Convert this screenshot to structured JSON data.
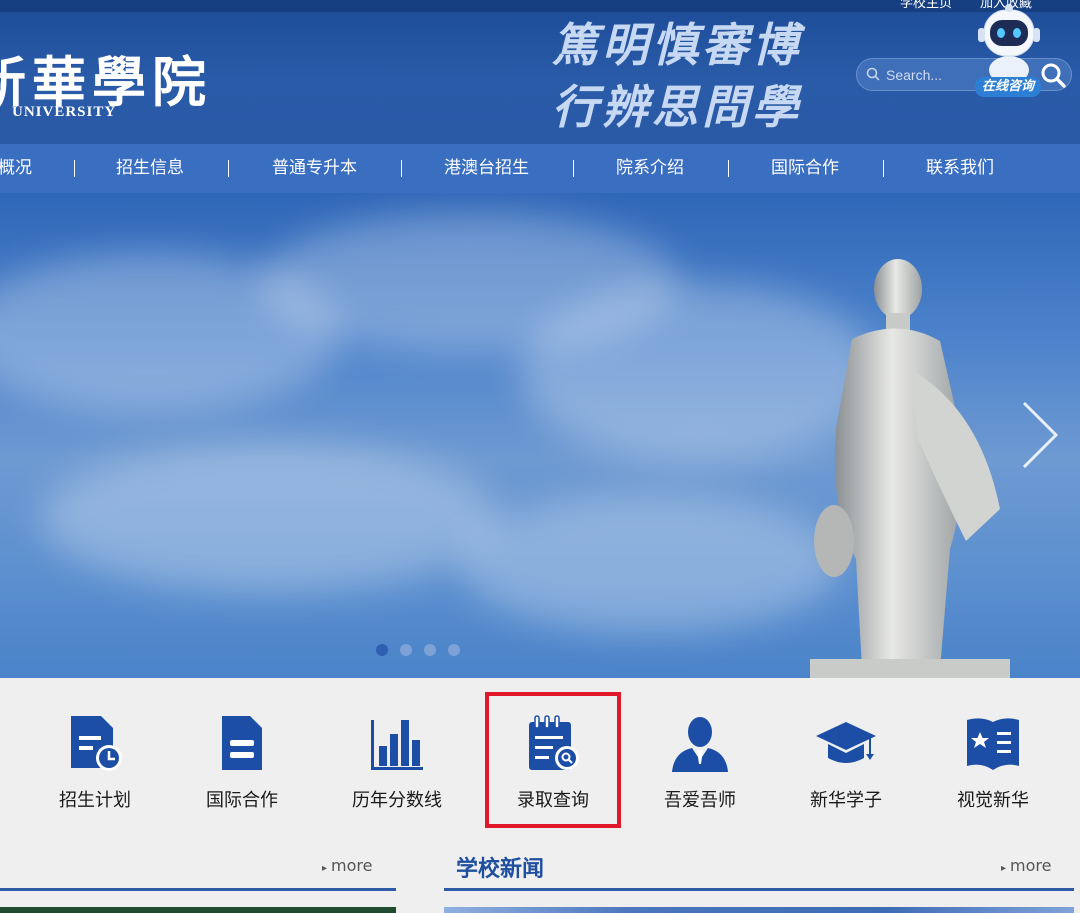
{
  "header": {
    "top_links": [
      "学校主页",
      "加入收藏"
    ],
    "logo_cn": "新華學院",
    "logo_en": "UNIVERSITY",
    "motto_line1": "篤明慎審博",
    "motto_line2": "行辨思問學",
    "search_placeholder": "Search...",
    "robot_label": "在线咨询"
  },
  "nav": {
    "items": [
      "学校概况",
      "招生信息",
      "普通专升本",
      "港澳台招生",
      "院系介绍",
      "国际合作",
      "联系我们"
    ]
  },
  "banner": {
    "slide_count": 4,
    "active_slide": 1
  },
  "quick_links": [
    {
      "label": "招生计划",
      "icon": "plan-document-clock-icon"
    },
    {
      "label": "国际合作",
      "icon": "document-icon"
    },
    {
      "label": "历年分数线",
      "icon": "bar-chart-icon"
    },
    {
      "label": "录取查询",
      "icon": "calendar-search-icon"
    },
    {
      "label": "吾爱吾师",
      "icon": "teacher-person-icon"
    },
    {
      "label": "新华学子",
      "icon": "graduation-cap-icon"
    },
    {
      "label": "视觉新华",
      "icon": "book-star-icon"
    }
  ],
  "sections": {
    "left_more": "more",
    "right_title": "学校新闻",
    "right_more": "more"
  },
  "colors": {
    "header_blue": "#2a5ba8",
    "nav_blue": "#3a6ec1",
    "icon_blue": "#1d4ea6",
    "highlight_red": "#e0182a"
  }
}
